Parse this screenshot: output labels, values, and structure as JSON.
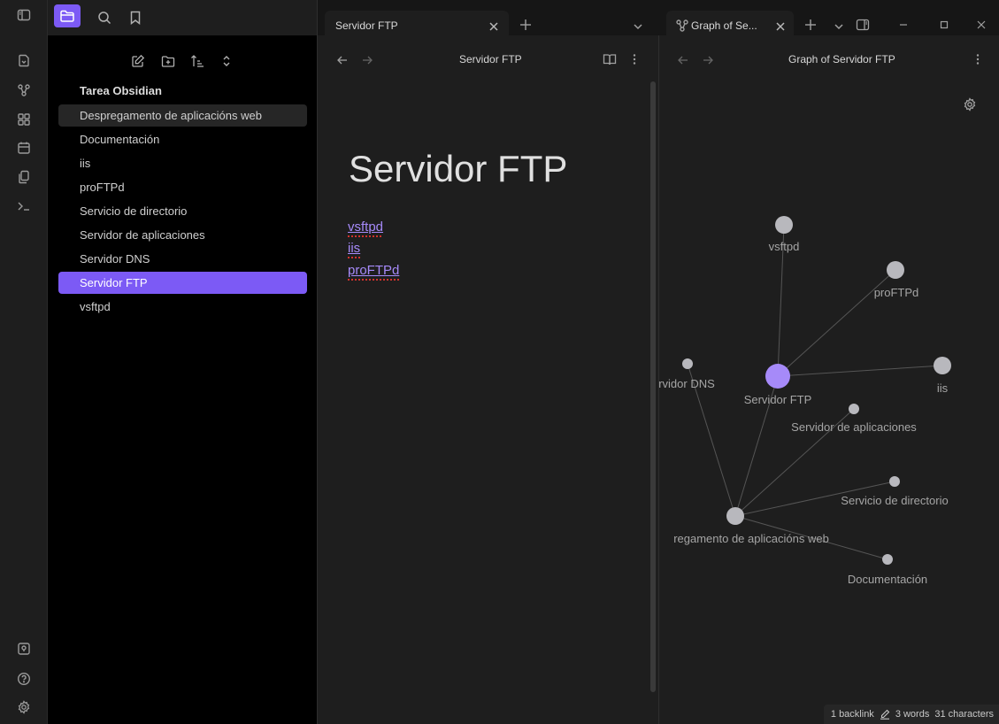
{
  "ribbon": {
    "top_icons": [
      "sidebar-toggle-icon",
      "open-quick-switcher-icon",
      "graph-view-icon",
      "canvas-icon",
      "daily-note-icon",
      "templates-icon",
      "command-palette-icon"
    ],
    "bottom_icons": [
      "vault-switcher-icon",
      "help-icon",
      "settings-icon"
    ]
  },
  "explorer": {
    "vault_name": "Tarea Obsidian",
    "files": [
      {
        "label": "Despregamento de aplicacións web",
        "state": "hover"
      },
      {
        "label": "Documentación",
        "state": ""
      },
      {
        "label": "iis",
        "state": ""
      },
      {
        "label": "proFTPd",
        "state": ""
      },
      {
        "label": "Servicio de directorio",
        "state": ""
      },
      {
        "label": "Servidor de aplicaciones",
        "state": ""
      },
      {
        "label": "Servidor DNS",
        "state": ""
      },
      {
        "label": "Servidor FTP",
        "state": "active"
      },
      {
        "label": "vsftpd",
        "state": ""
      }
    ]
  },
  "editor": {
    "tab_title": "Servidor FTP",
    "view_title": "Servidor FTP",
    "note_title": "Servidor FTP",
    "links": [
      "vsftpd",
      "iis",
      "proFTPd"
    ]
  },
  "graph": {
    "tab_title": "Graph of Se...",
    "view_title": "Graph of Servidor FTP",
    "nodes": {
      "vsftpd": "vsftpd",
      "proftpd": "proFTPd",
      "dns": "rvidor DNS",
      "ftp": "Servidor FTP",
      "iis": "iis",
      "aplicaciones": "Servidor de aplicaciones",
      "directorio": "Servicio de directorio",
      "despregamento": "regamento de aplicacións web",
      "documentacion": "Documentación"
    }
  },
  "status": {
    "backlinks": "1 backlink",
    "words": "3 words",
    "characters": "31 characters"
  },
  "colors": {
    "accent": "#7c5af5",
    "link": "#a68af9",
    "background": "#1e1e1e"
  }
}
